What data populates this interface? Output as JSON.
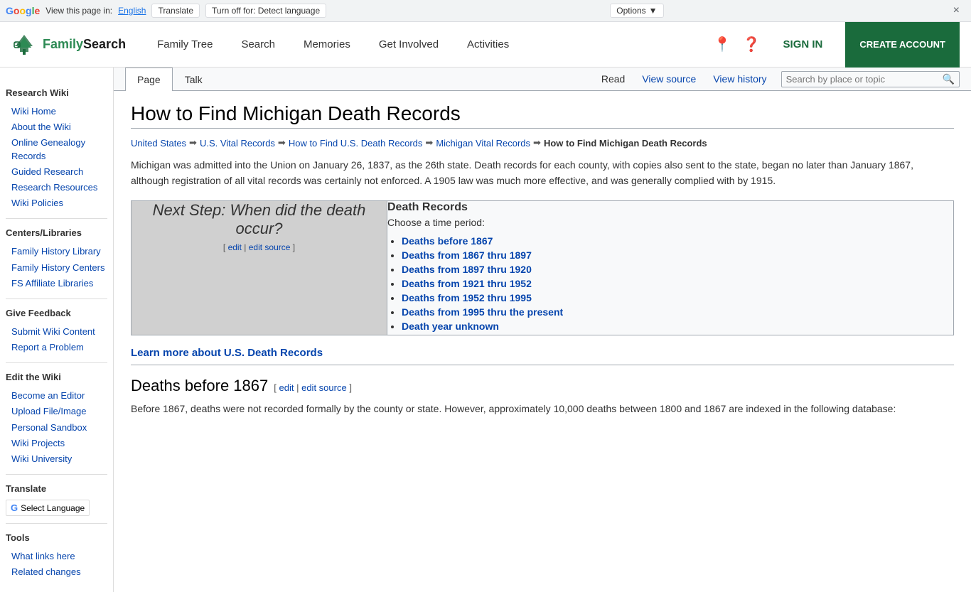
{
  "translate_bar": {
    "view_text": "View this page in:",
    "language": "English",
    "translate_btn": "Translate",
    "turn_off_btn": "Turn off for: Detect language",
    "options_btn": "Options",
    "options_arrow": "▼",
    "close": "×"
  },
  "header": {
    "logo_text": "FamilySearch",
    "nav": [
      {
        "label": "Family Tree",
        "id": "family-tree"
      },
      {
        "label": "Search",
        "id": "search"
      },
      {
        "label": "Memories",
        "id": "memories"
      },
      {
        "label": "Get Involved",
        "id": "get-involved"
      },
      {
        "label": "Activities",
        "id": "activities"
      }
    ],
    "sign_in": "SIGN IN",
    "create_account": "CREATE ACCOUNT"
  },
  "sidebar": {
    "sections": [
      {
        "title": "Research Wiki",
        "links": [
          {
            "label": "Wiki Home",
            "id": "wiki-home"
          },
          {
            "label": "About the Wiki",
            "id": "about-wiki"
          },
          {
            "label": "Online Genealogy Records",
            "id": "online-genealogy"
          },
          {
            "label": "Guided Research",
            "id": "guided-research"
          },
          {
            "label": "Research Resources",
            "id": "research-resources"
          },
          {
            "label": "Wiki Policies",
            "id": "wiki-policies"
          }
        ]
      },
      {
        "title": "Centers/Libraries",
        "links": [
          {
            "label": "Family History Library",
            "id": "fhl"
          },
          {
            "label": "Family History Centers",
            "id": "fhc"
          },
          {
            "label": "FS Affiliate Libraries",
            "id": "fs-affiliate"
          }
        ]
      },
      {
        "title": "Give Feedback",
        "links": [
          {
            "label": "Submit Wiki Content",
            "id": "submit-wiki"
          },
          {
            "label": "Report a Problem",
            "id": "report-problem"
          }
        ]
      },
      {
        "title": "Edit the Wiki",
        "links": [
          {
            "label": "Become an Editor",
            "id": "become-editor"
          },
          {
            "label": "Upload File/Image",
            "id": "upload-file"
          },
          {
            "label": "Personal Sandbox",
            "id": "personal-sandbox"
          },
          {
            "label": "Wiki Projects",
            "id": "wiki-projects"
          },
          {
            "label": "Wiki University",
            "id": "wiki-university"
          }
        ]
      },
      {
        "title": "Translate",
        "is_translate": true
      },
      {
        "title": "Tools",
        "links": [
          {
            "label": "What links here",
            "id": "what-links"
          },
          {
            "label": "Related changes",
            "id": "related-changes"
          }
        ]
      }
    ],
    "select_language": "Select Language"
  },
  "page_tabs": {
    "tabs": [
      {
        "label": "Page",
        "active": true
      },
      {
        "label": "Talk",
        "active": false
      }
    ],
    "actions": [
      {
        "label": "Read"
      },
      {
        "label": "View source"
      },
      {
        "label": "View history"
      }
    ],
    "search_placeholder": "Search by place or topic"
  },
  "article": {
    "title": "How to Find Michigan Death Records",
    "breadcrumb": [
      {
        "label": "United States",
        "link": true
      },
      {
        "label": "U.S. Vital Records",
        "link": true
      },
      {
        "label": "How to Find U.S. Death Records",
        "link": true
      },
      {
        "label": "Michigan Vital Records",
        "link": true
      },
      {
        "label": "How to Find Michigan Death Records",
        "link": false
      }
    ],
    "intro": "Michigan was admitted into the Union on January 26, 1837, as the 26th state. Death records for each county, with copies also sent to the state, began no later than January 1867, although registration of all vital records was certainly not enforced. A 1905 law was much more effective, and was generally complied with by 1915.",
    "info_box": {
      "left": {
        "next_step": "Next Step: When did the death occur?",
        "edit_label": "[ edit | edit source ]"
      },
      "right": {
        "title": "Death Records",
        "choose": "Choose a time period:",
        "links": [
          "Deaths before 1867",
          "Deaths from 1867 thru 1897",
          "Deaths from 1897 thru 1920",
          "Deaths from 1921 thru 1952",
          "Deaths from 1952 thru 1995",
          "Deaths from 1995 thru the present",
          "Death year unknown"
        ]
      }
    },
    "learn_more": "Learn more about U.S. Death Records",
    "section1": {
      "heading": "Deaths before 1867",
      "edit_label": "[ edit | edit source ]",
      "body": "Before 1867, deaths were not recorded formally by the county or state. However, approximately 10,000 deaths between 1800 and 1867 are indexed in the following database:"
    }
  }
}
